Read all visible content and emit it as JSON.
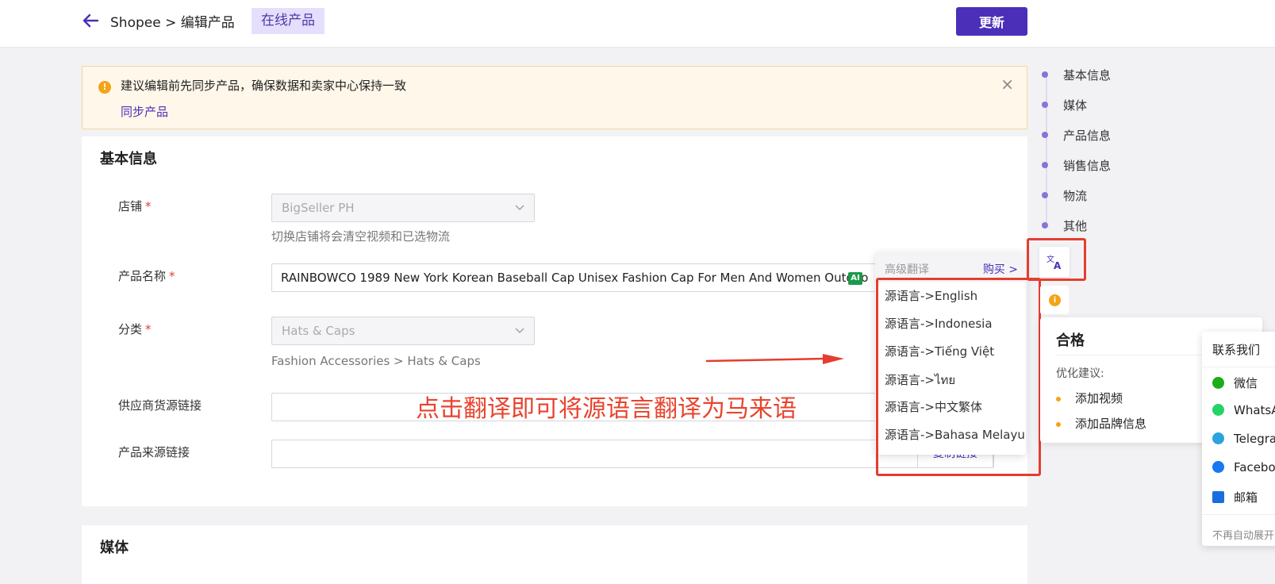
{
  "header": {
    "breadcrumb": "Shopee > 编辑产品",
    "status_badge": "在线产品",
    "update_label": "更新"
  },
  "alert": {
    "message": "建议编辑前先同步产品，确保数据和卖家中心保持一致",
    "link": "同步产品",
    "close": "×"
  },
  "basic": {
    "title": "基本信息",
    "shop_label": "店铺",
    "shop_value": "BigSeller PH",
    "shop_hint": "切换店铺将会清空视频和已选物流",
    "name_label": "产品名称",
    "name_value": "RAINBOWCO 1989 New York Korean Baseball Cap Unisex Fashion Cap For Men And Women Outdoo",
    "ai_badge": "AI",
    "category_label": "分类",
    "category_value": "Hats & Caps",
    "category_path": "Fashion Accessories > Hats & Caps",
    "supplier_label": "供应商货源链接",
    "source_label": "产品来源链接",
    "copy_link": "复制链接",
    "required_mark": "*"
  },
  "media": {
    "title": "媒体"
  },
  "annotation": "点击翻译即可将源语言翻译为马来语",
  "translate_menu": {
    "header_label": "高级翻译",
    "buy_label": "购买 >",
    "items": [
      "源语言->English",
      "源语言->Indonesia",
      "源语言->Tiếng Việt",
      "源语言->ไทย",
      "源语言->中文繁体",
      "源语言->Bahasa Melayu"
    ]
  },
  "side_nav": {
    "items": [
      "基本信息",
      "媒体",
      "产品信息",
      "销售信息",
      "物流",
      "其他"
    ]
  },
  "score_panel": {
    "title": "合格",
    "subtitle": "优化建议:",
    "suggestions": [
      "添加视频",
      "添加品牌信息"
    ]
  },
  "contact": {
    "title": "联系我们",
    "items": [
      "微信",
      "WhatsApp",
      "Telegram",
      "Facebook",
      "邮箱"
    ],
    "footer": "不再自动展开"
  },
  "colors": {
    "brand": "#4b2fb8",
    "alert_bg": "#fff7e9",
    "annotation_red": "#e53d2f"
  }
}
